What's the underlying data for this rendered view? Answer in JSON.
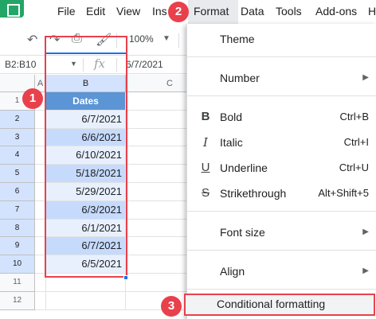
{
  "menubar": {
    "items": [
      "File",
      "Edit",
      "View",
      "Ins",
      "Format",
      "Data",
      "Tools",
      "Add-ons",
      "H"
    ]
  },
  "toolbar": {
    "zoom": "100%",
    "icons": [
      "undo-icon",
      "redo-icon",
      "print-icon",
      "paint-format-icon"
    ]
  },
  "formula_bar": {
    "name_box": "B2:B10",
    "fx": "fx",
    "value": "6/7/2021"
  },
  "grid": {
    "columns": [
      "A",
      "B",
      "C"
    ],
    "rows": [
      "1",
      "2",
      "3",
      "4",
      "5",
      "6",
      "7",
      "8",
      "9",
      "10",
      "11",
      "12"
    ],
    "header": "Dates",
    "dates": [
      "6/7/2021",
      "6/6/2021",
      "6/10/2021",
      "5/18/2021",
      "5/29/2021",
      "6/3/2021",
      "6/1/2021",
      "6/7/2021",
      "6/5/2021"
    ]
  },
  "format_menu": {
    "theme": "Theme",
    "number": "Number",
    "bold": "Bold",
    "bold_shortcut": "Ctrl+B",
    "italic": "Italic",
    "italic_shortcut": "Ctrl+I",
    "underline": "Underline",
    "underline_shortcut": "Ctrl+U",
    "strikethrough": "Strikethrough",
    "strikethrough_shortcut": "Alt+Shift+5",
    "font_size": "Font size",
    "align": "Align",
    "conditional_formatting": "Conditional formatting"
  },
  "badges": [
    "1",
    "2",
    "3"
  ],
  "colors": {
    "accent_red": "#e8414c",
    "header_blue": "#5b95d6",
    "sheets_green": "#23a566"
  }
}
